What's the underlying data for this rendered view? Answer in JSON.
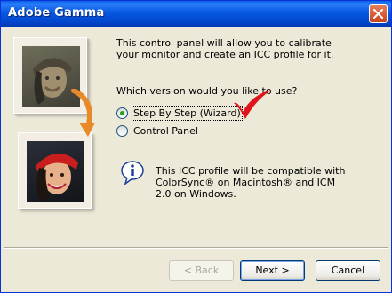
{
  "window": {
    "title": "Adobe Gamma"
  },
  "main": {
    "intro_line1": "This control panel will allow you to calibrate",
    "intro_line2": "your monitor and create an ICC profile for it.",
    "question": "Which version would you like to use?",
    "options": [
      {
        "label": "Step By Step (Wizard)",
        "selected": true
      },
      {
        "label": "Control Panel",
        "selected": false
      }
    ],
    "info_line1": "This ICC profile will be compatible with",
    "info_line2": "ColorSync® on Macintosh® and ICM",
    "info_line3": "2.0 on Windows."
  },
  "buttons": {
    "back": "< Back",
    "next": "Next >",
    "cancel": "Cancel"
  },
  "colors": {
    "titlebar": "#0757e0",
    "background": "#ece9d8",
    "checkmark": "#e0151c",
    "arrow": "#e8892a"
  }
}
